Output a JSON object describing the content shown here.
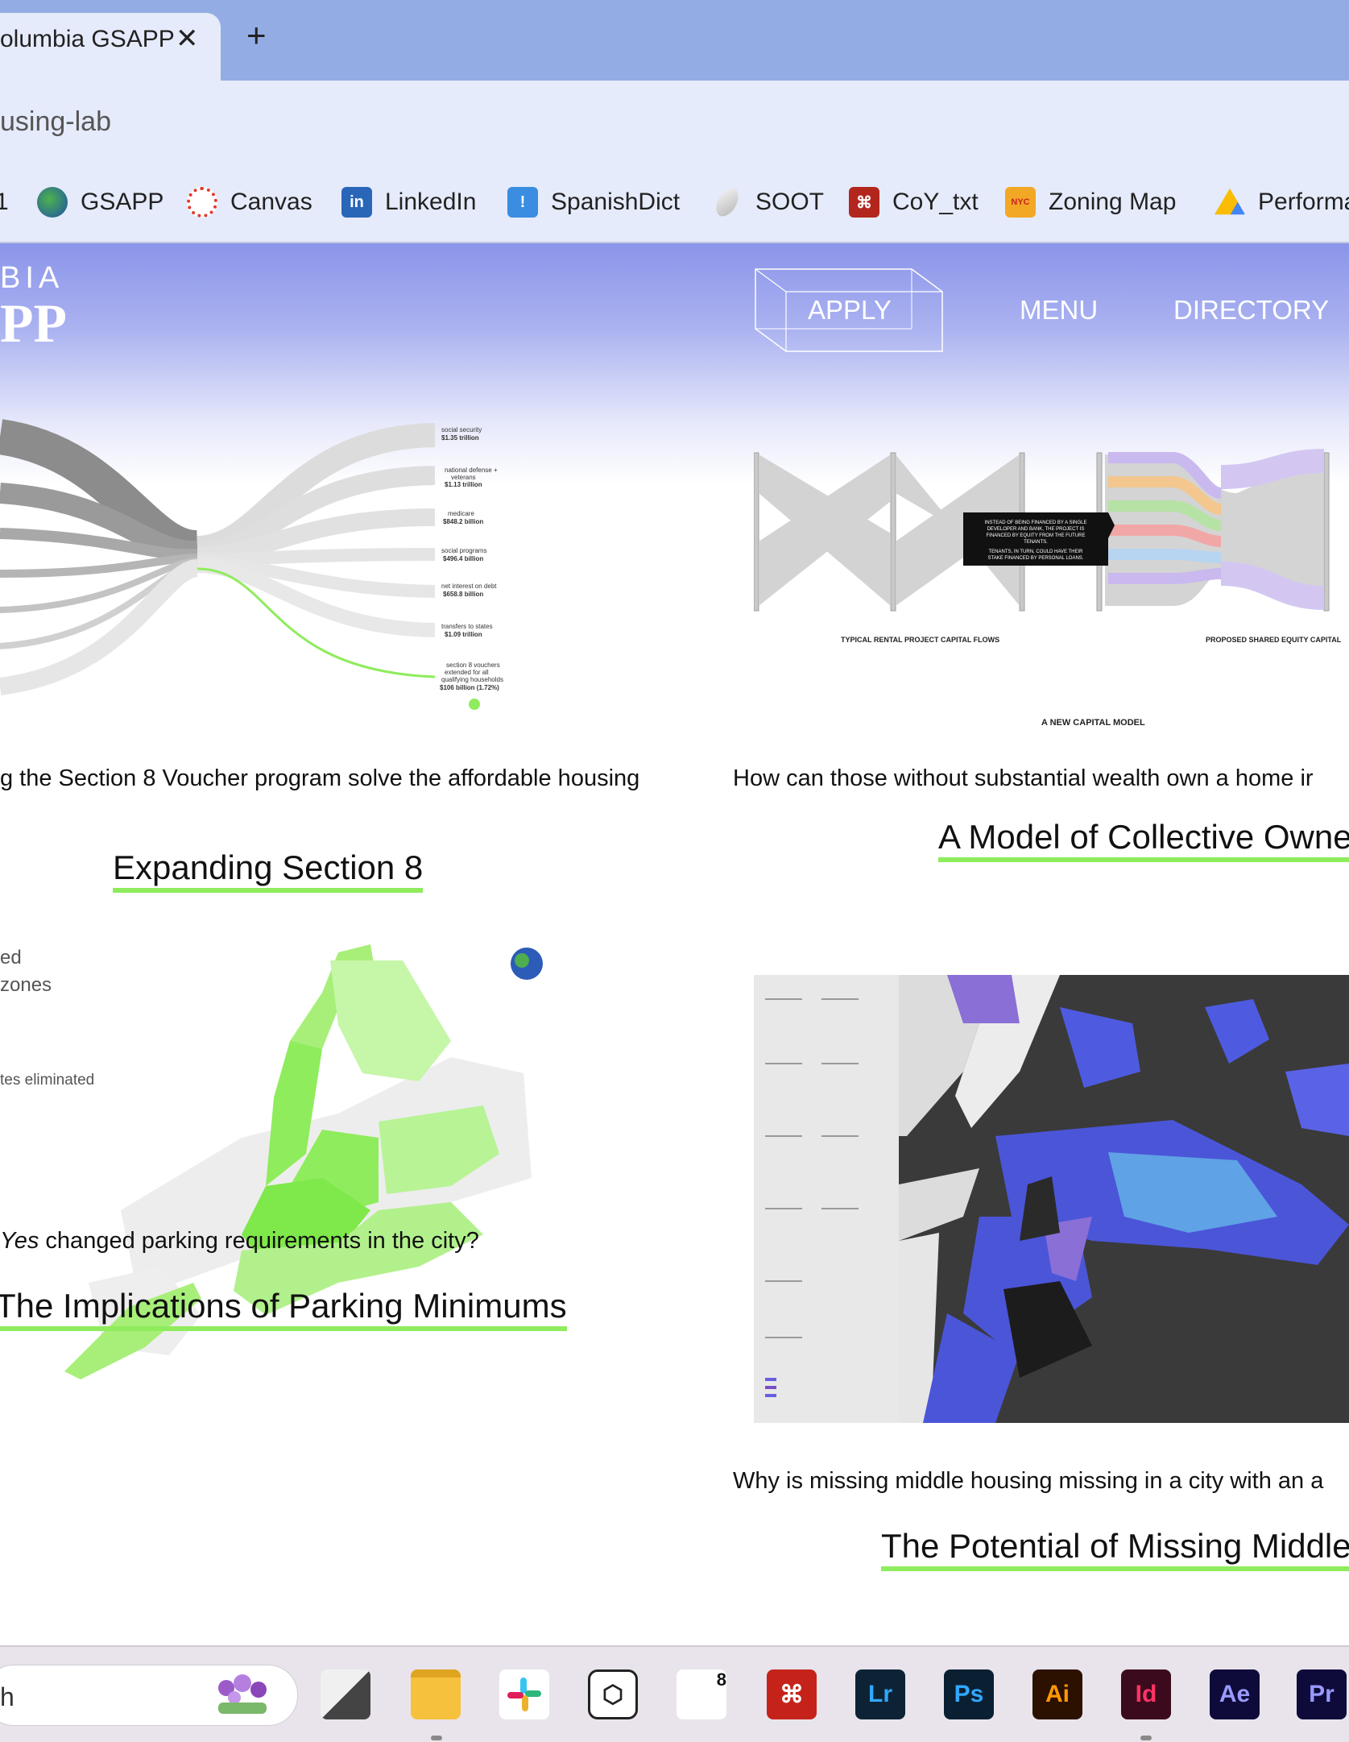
{
  "browser": {
    "tab_title": "olumbia GSAPP",
    "tab_close": "✕",
    "new_tab": "+",
    "url": "using-lab",
    "bookmarks": [
      {
        "label": "1",
        "icon": "bookmark-icon"
      },
      {
        "label": "GSAPP",
        "icon": "globe-icon"
      },
      {
        "label": "Canvas",
        "icon": "canvas-icon"
      },
      {
        "label": "LinkedIn",
        "icon": "linkedin-icon"
      },
      {
        "label": "SpanishDict",
        "icon": "spanishdict-icon"
      },
      {
        "label": "SOOT",
        "icon": "soot-icon"
      },
      {
        "label": "CoY_txt",
        "icon": "pdf-icon"
      },
      {
        "label": "Zoning Map",
        "icon": "nyc-planning-icon"
      },
      {
        "label": "Performa",
        "icon": "google-drive-icon"
      }
    ]
  },
  "site": {
    "logo_top": "BIA",
    "logo_bottom": "PP",
    "nav": {
      "apply": "APPLY",
      "menu": "MENU",
      "directory": "DIRECTORY"
    }
  },
  "projects": [
    {
      "description": "g the Section 8 Voucher program solve the affordable housing",
      "title": "Expanding Section 8",
      "figure_labels": [
        "social security $1.35 trillion",
        "national defense + veterans $1.13 trillion",
        "medicare $848.2 billion",
        "social programs $496.4 billion",
        "net interest on debt $658.8 billion",
        "transfers to states $1.09 trillion",
        "section 8 vouchers extended for all qualifying households $106 billion (1.72%)"
      ]
    },
    {
      "description": "How can those without substantial wealth own a home ir",
      "title": "A Model of Collective Owne",
      "figure_labels": [
        "INSTEAD OF BEING FINANCED BY A SINGLE DEVELOPER AND BANK, THE PROJECT IS FINANCED BY EQUITY FROM THE FUTURE TENANTS.",
        "TENANTS, IN TURN, COULD HAVE THEIR STAKE FINANCED BY PERSONAL LOANS.",
        "TYPICAL RENTAL PROJECT CAPITAL FLOWS",
        "PROPOSED SHARED EQUITY CAPITAL",
        "A NEW CAPITAL MODEL"
      ]
    },
    {
      "description_italic": "Yes",
      "description": " changed parking requirements in the city?",
      "title": "The Implications of Parking Minimums",
      "figure_labels": [
        "ed",
        "zones",
        "tes eliminated"
      ]
    },
    {
      "description": "Why is missing middle housing missing in a city with an a",
      "title": "The Potential of Missing Middle",
      "figure_labels": []
    }
  ],
  "taskbar": {
    "search_text": "h",
    "apps": [
      {
        "name": "task-view-icon",
        "label": ""
      },
      {
        "name": "file-explorer-icon",
        "label": ""
      },
      {
        "name": "slack-icon",
        "label": ""
      },
      {
        "name": "blender-cube-icon",
        "label": ""
      },
      {
        "name": "rhino-icon",
        "label": "8"
      },
      {
        "name": "acrobat-icon",
        "label": ""
      },
      {
        "name": "lightroom-icon",
        "label": "Lr"
      },
      {
        "name": "photoshop-icon",
        "label": "Ps"
      },
      {
        "name": "illustrator-icon",
        "label": "Ai"
      },
      {
        "name": "indesign-icon",
        "label": "Id"
      },
      {
        "name": "after-effects-icon",
        "label": "Ae"
      },
      {
        "name": "premiere-icon",
        "label": "Pr"
      }
    ]
  },
  "colors": {
    "accent_green": "#8fec5c",
    "header_blue": "#8b95ea",
    "tab_blue": "#93ade4"
  }
}
